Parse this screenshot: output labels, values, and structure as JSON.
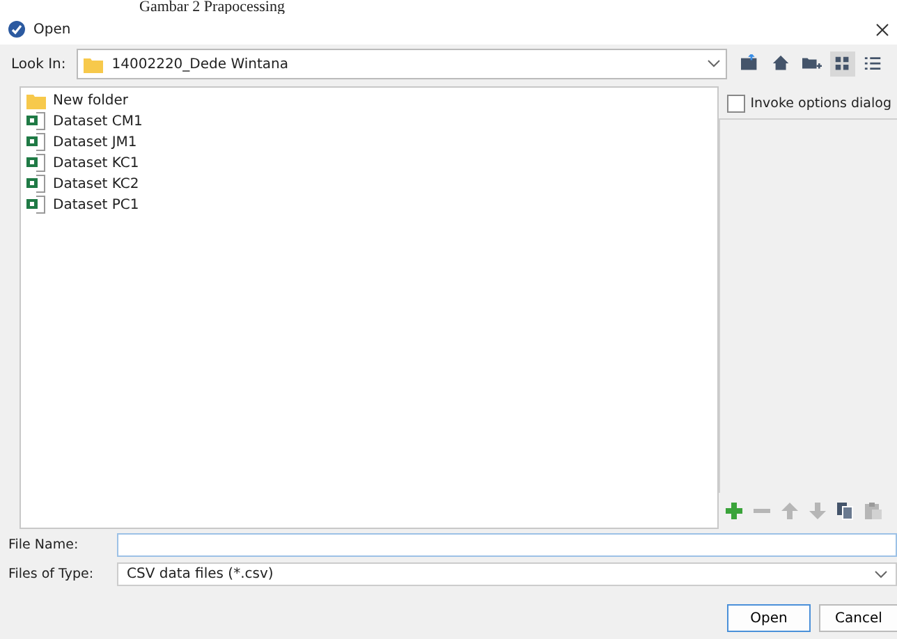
{
  "caption": "Gambar 2 Prapocessing",
  "window": {
    "title": "Open"
  },
  "look_in": {
    "label": "Look In:",
    "value": "14002220_Dede Wintana"
  },
  "toolbar": [
    {
      "kind": "up",
      "selected": false
    },
    {
      "kind": "home",
      "selected": false
    },
    {
      "kind": "newfolder",
      "selected": false
    },
    {
      "kind": "grid",
      "selected": true
    },
    {
      "kind": "list",
      "selected": false
    }
  ],
  "files": [
    {
      "name": "New folder",
      "kind": "folder"
    },
    {
      "name": "Dataset CM1",
      "kind": "file"
    },
    {
      "name": "Dataset JM1",
      "kind": "file"
    },
    {
      "name": "Dataset KC1",
      "kind": "file"
    },
    {
      "name": "Dataset KC2",
      "kind": "file"
    },
    {
      "name": "Dataset PC1",
      "kind": "file"
    }
  ],
  "invoke_options": {
    "label": "Invoke options dialog",
    "checked": false
  },
  "options_tools": [
    {
      "kind": "add",
      "disabled": false
    },
    {
      "kind": "remove",
      "disabled": true
    },
    {
      "kind": "up",
      "disabled": true
    },
    {
      "kind": "down",
      "disabled": true
    },
    {
      "kind": "copy",
      "disabled": false
    },
    {
      "kind": "paste",
      "disabled": true
    }
  ],
  "file_name": {
    "label": "File Name:"
  },
  "files_of_type": {
    "label": "Files of Type:",
    "value": "CSV data files (*.csv)"
  },
  "buttons": [
    {
      "label": "Open",
      "default": true
    },
    {
      "label": "Cancel",
      "default": false
    }
  ]
}
